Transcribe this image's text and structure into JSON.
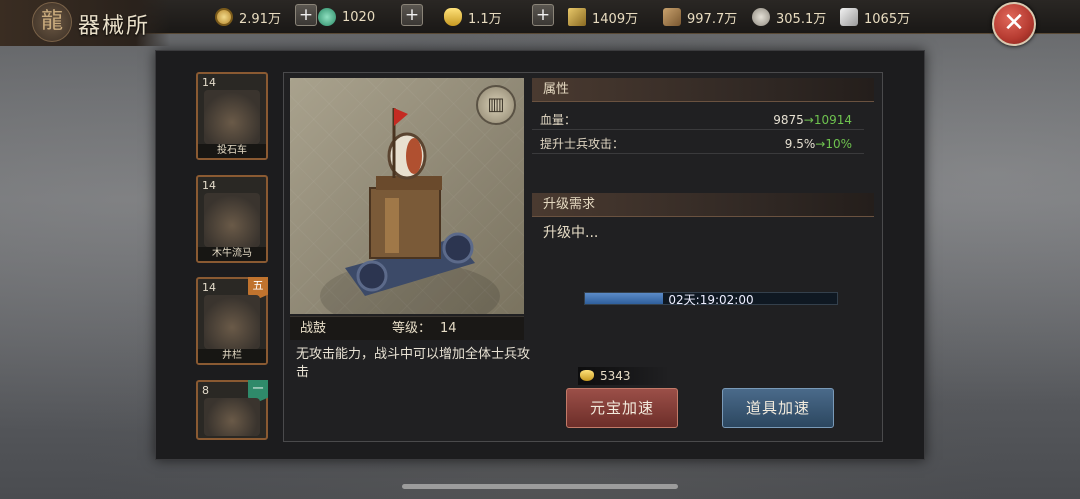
{
  "header": {
    "title": "器械所",
    "resources": [
      {
        "icon": "copper-coin-icon",
        "value": "2.91万"
      },
      {
        "icon": "jade-icon",
        "value": "1020"
      },
      {
        "icon": "gold-ingot-icon",
        "value": "1.1万"
      },
      {
        "icon": "grain-icon",
        "value": "1409万"
      },
      {
        "icon": "wood-icon",
        "value": "997.7万"
      },
      {
        "icon": "stone-icon",
        "value": "305.1万"
      },
      {
        "icon": "iron-icon",
        "value": "1065万"
      }
    ],
    "plus": "+",
    "close": "✕"
  },
  "units": [
    {
      "level": "14",
      "name": "投石车",
      "badge": ""
    },
    {
      "level": "14",
      "name": "木牛流马",
      "badge": ""
    },
    {
      "level": "14",
      "name": "井栏",
      "badge": "五"
    },
    {
      "level": "8",
      "name": "",
      "badge": "一"
    }
  ],
  "selected": {
    "name": "战鼓",
    "level_label": "等级：",
    "level": "14",
    "description": "无攻击能力，战斗中可以增加全体士兵攻击"
  },
  "attributes": {
    "title": "属性",
    "rows": [
      {
        "label": "血量：",
        "current": "9875",
        "arrow": "→",
        "next": "10914"
      },
      {
        "label": "提升士兵攻击：",
        "current": "9.5%",
        "arrow": "→",
        "next": "10%"
      }
    ]
  },
  "upgrade": {
    "title": "升级需求",
    "status": "升级中...",
    "progress_fraction": 0.31,
    "timer": "02天:19:02:00",
    "cost": "5343",
    "gold_speedup": "元宝加速",
    "item_speedup": "道具加速"
  },
  "colors": {
    "accent_green": "#6ec24f",
    "close_red": "#c0392b",
    "progress_blue": "#3f73b4"
  }
}
